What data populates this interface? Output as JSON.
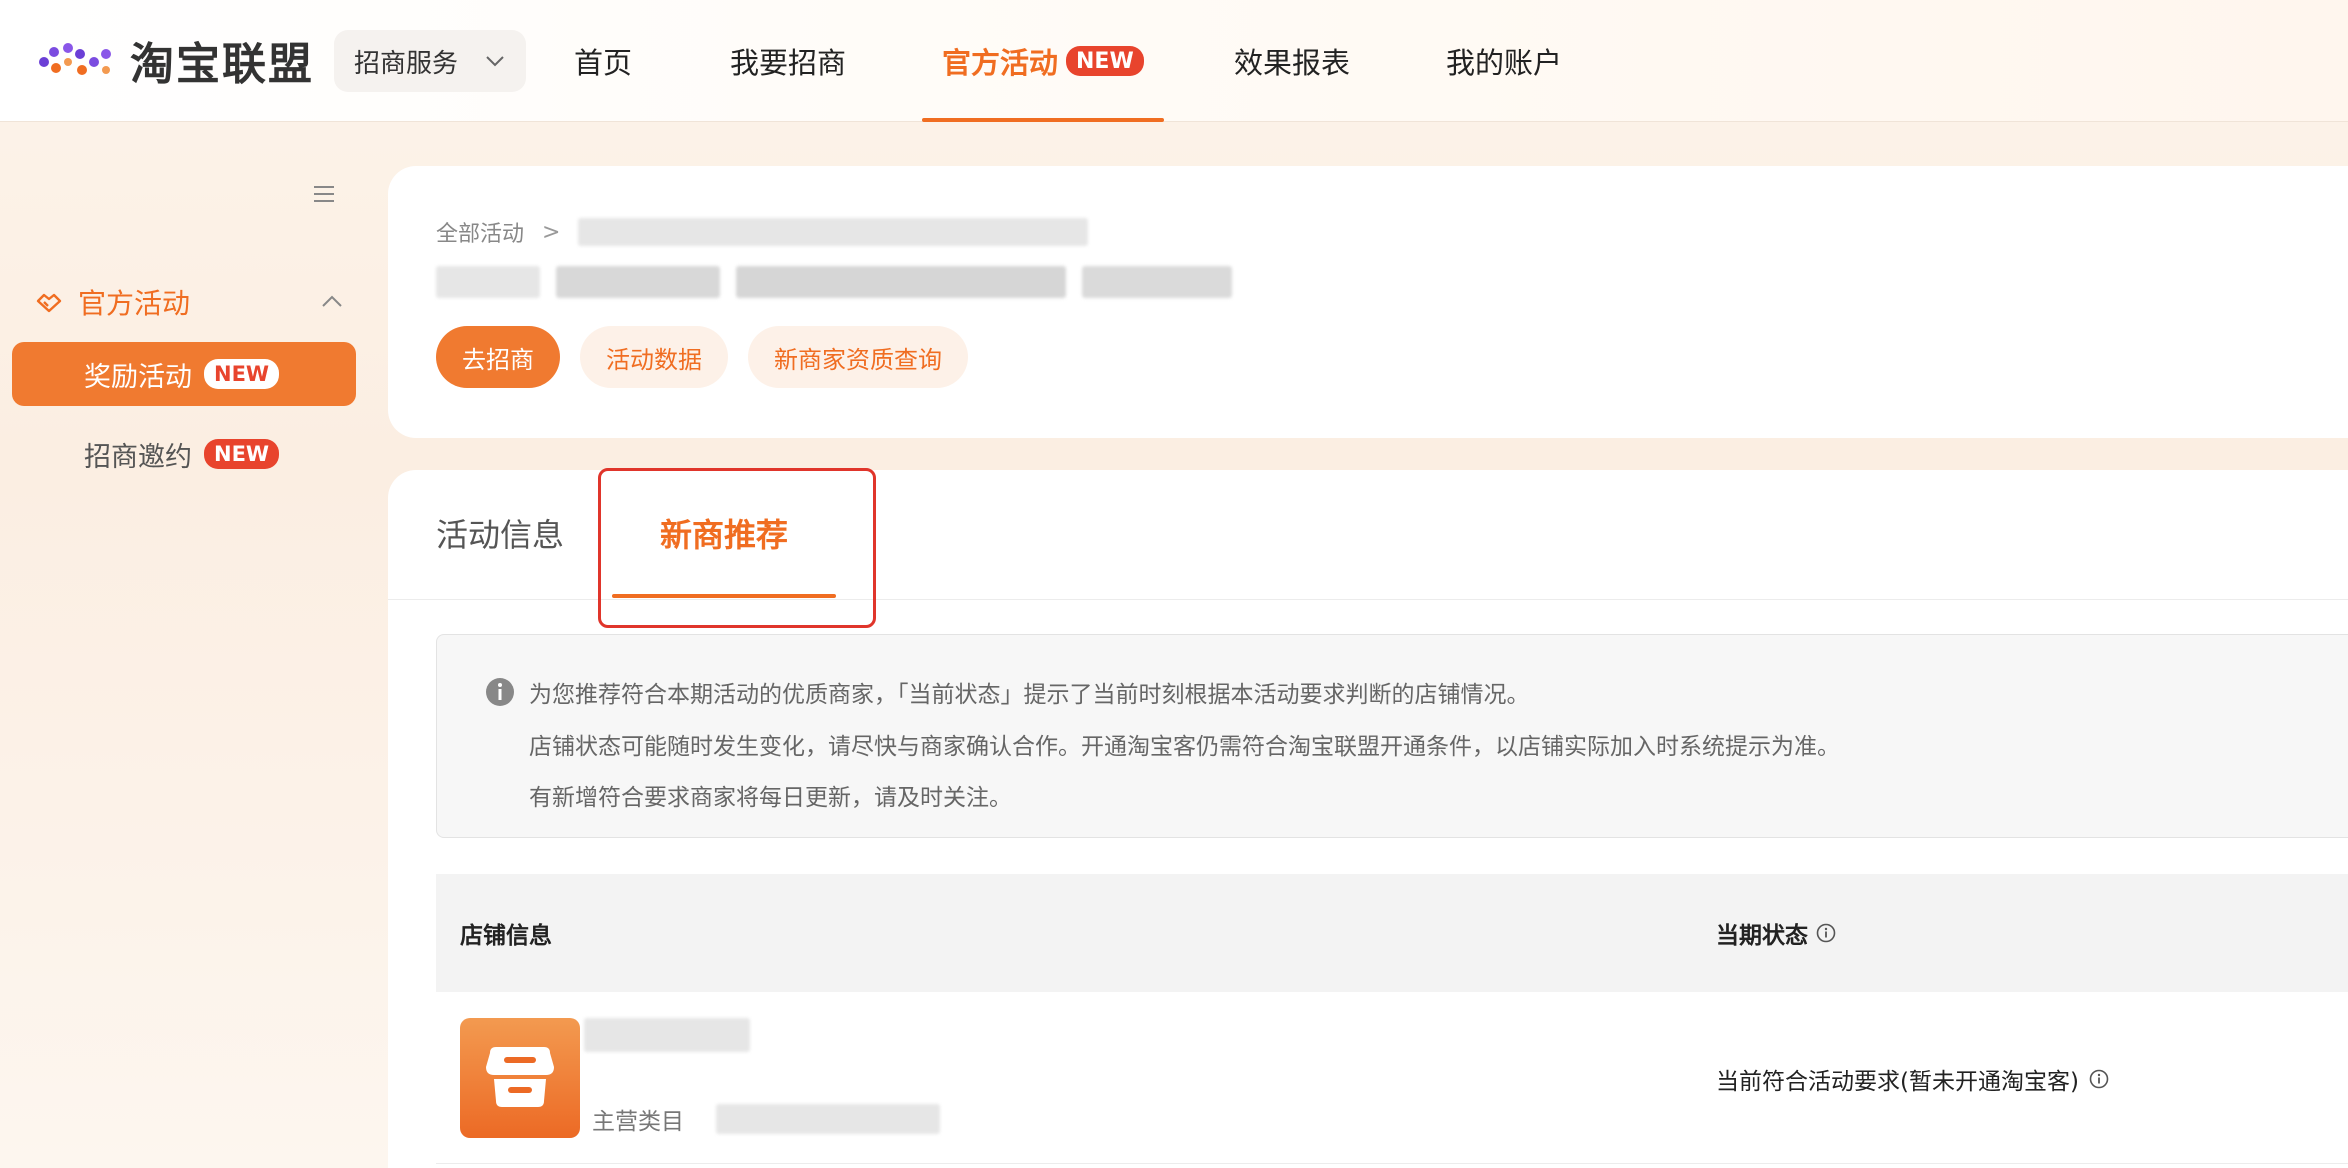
{
  "brand": {
    "name": "淘宝联盟"
  },
  "top_nav": {
    "service_select": {
      "value": "招商服务"
    },
    "items": [
      {
        "label": "首页"
      },
      {
        "label": "我要招商"
      },
      {
        "label": "官方活动",
        "badge": "NEW",
        "active": true
      },
      {
        "label": "效果报表"
      },
      {
        "label": "我的账户"
      }
    ]
  },
  "sidebar": {
    "group": {
      "label": "官方活动",
      "expanded": true
    },
    "items": [
      {
        "label": "奖励活动",
        "badge": "NEW",
        "active": true
      },
      {
        "label": "招商邀约",
        "badge": "NEW"
      }
    ]
  },
  "header": {
    "breadcrumb": {
      "root": "全部活动",
      "separator": ">"
    },
    "actions": [
      {
        "label": "去招商"
      },
      {
        "label": "活动数据"
      },
      {
        "label": "新商家资质查询"
      }
    ]
  },
  "tabs": [
    {
      "label": "活动信息"
    },
    {
      "label": "新商推荐",
      "active": true
    }
  ],
  "notice": {
    "lines": [
      "为您推荐符合本期活动的优质商家，「当前状态」提示了当前时刻根据本活动要求判断的店铺情况。",
      "店铺状态可能随时发生变化，请尽快与商家确认合作。开通淘宝客仍需符合淘宝联盟开通条件，以店铺实际加入时系统提示为准。",
      "有新增符合要求商家将每日更新，请及时关注。"
    ]
  },
  "table": {
    "columns": [
      "店铺信息",
      "当期状态"
    ],
    "rows": [
      {
        "category_label": "主营类目",
        "status": "当前符合活动要求(暂未开通淘宝客)"
      }
    ]
  },
  "colors": {
    "accent": "#f06d21",
    "badge": "#e8442d",
    "highlight_border": "#e0352b"
  }
}
